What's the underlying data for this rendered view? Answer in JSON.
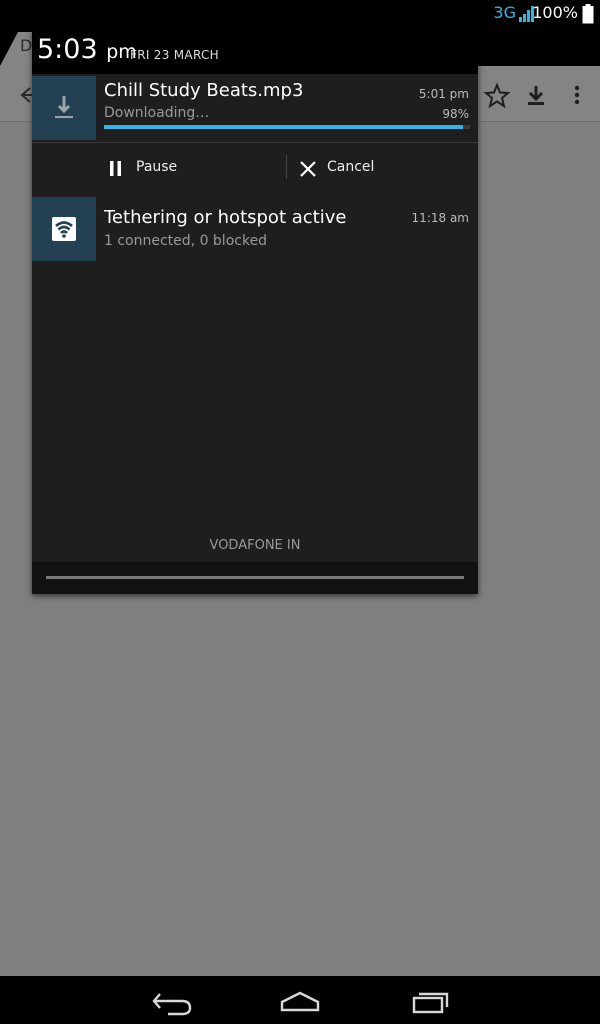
{
  "status_bar": {
    "network_type": "3G",
    "battery_percent": "100%",
    "accent_color": "#33b5e5"
  },
  "background_page": {
    "tab_letter": "D",
    "icons": [
      "back-arrow-icon",
      "star-icon",
      "download-icon",
      "overflow-menu-icon"
    ]
  },
  "panel": {
    "time": "5:03",
    "ampm": "pm",
    "date": "FRI 23 MARCH",
    "download": {
      "icon": "download-icon",
      "title": "Chill Study Beats.mp3",
      "time": "5:01 pm",
      "status": "Downloading…",
      "percent_label": "98%",
      "progress": 0.98,
      "actions": {
        "pause_label": "Pause",
        "cancel_label": "Cancel"
      }
    },
    "tethering": {
      "icon": "wifi-hotspot-icon",
      "title": "Tethering or hotspot active",
      "time": "11:18 am",
      "subtitle": "1 connected, 0 blocked"
    },
    "carrier": "VODAFONE IN"
  },
  "nav_bar": {
    "icons": [
      "back-icon",
      "home-icon",
      "recent-apps-icon"
    ]
  }
}
